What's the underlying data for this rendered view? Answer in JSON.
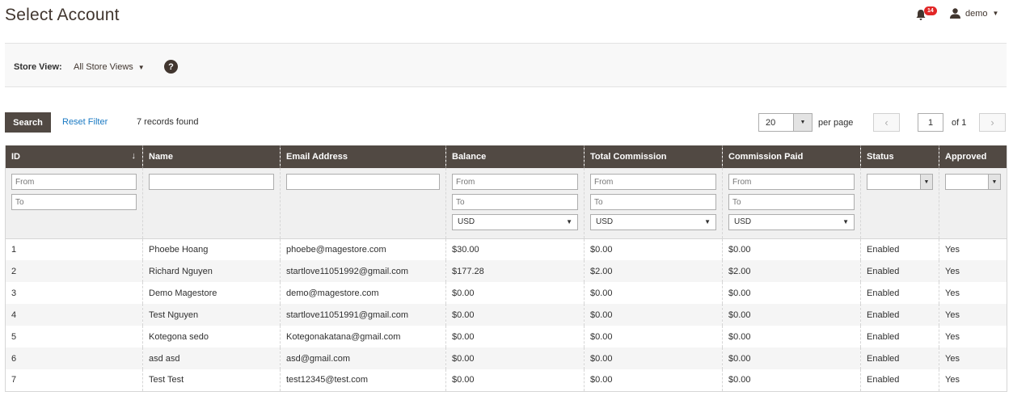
{
  "header": {
    "title": "Select Account",
    "notifications_count": "14",
    "username": "demo"
  },
  "store": {
    "label": "Store View:",
    "value": "All Store Views"
  },
  "toolbar": {
    "search_label": "Search",
    "reset_label": "Reset Filter",
    "records_text": "7 records found",
    "per_page_value": "20",
    "per_page_label": "per page",
    "page_value": "1",
    "page_of": "of 1"
  },
  "columns": [
    "ID",
    "Name",
    "Email Address",
    "Balance",
    "Total Commission",
    "Commission Paid",
    "Status",
    "Approved"
  ],
  "filters": {
    "from_placeholder": "From",
    "to_placeholder": "To",
    "currency": "USD"
  },
  "rows": [
    [
      "1",
      "Phoebe Hoang",
      "phoebe@magestore.com",
      "$30.00",
      "$0.00",
      "$0.00",
      "Enabled",
      "Yes"
    ],
    [
      "2",
      "Richard Nguyen",
      "startlove11051992@gmail.com",
      "$177.28",
      "$2.00",
      "$2.00",
      "Enabled",
      "Yes"
    ],
    [
      "3",
      "Demo Magestore",
      "demo@magestore.com",
      "$0.00",
      "$0.00",
      "$0.00",
      "Enabled",
      "Yes"
    ],
    [
      "4",
      "Test Nguyen",
      "startlove11051991@gmail.com",
      "$0.00",
      "$0.00",
      "$0.00",
      "Enabled",
      "Yes"
    ],
    [
      "5",
      "Kotegona sedo",
      "Kotegonakatana@gmail.com",
      "$0.00",
      "$0.00",
      "$0.00",
      "Enabled",
      "Yes"
    ],
    [
      "6",
      "asd asd",
      "asd@gmail.com",
      "$0.00",
      "$0.00",
      "$0.00",
      "Enabled",
      "Yes"
    ],
    [
      "7",
      "Test Test",
      "test12345@test.com",
      "$0.00",
      "$0.00",
      "$0.00",
      "Enabled",
      "Yes"
    ]
  ],
  "colors": {
    "header_bg": "#514943",
    "link": "#1979c3",
    "badge": "#e22626"
  }
}
